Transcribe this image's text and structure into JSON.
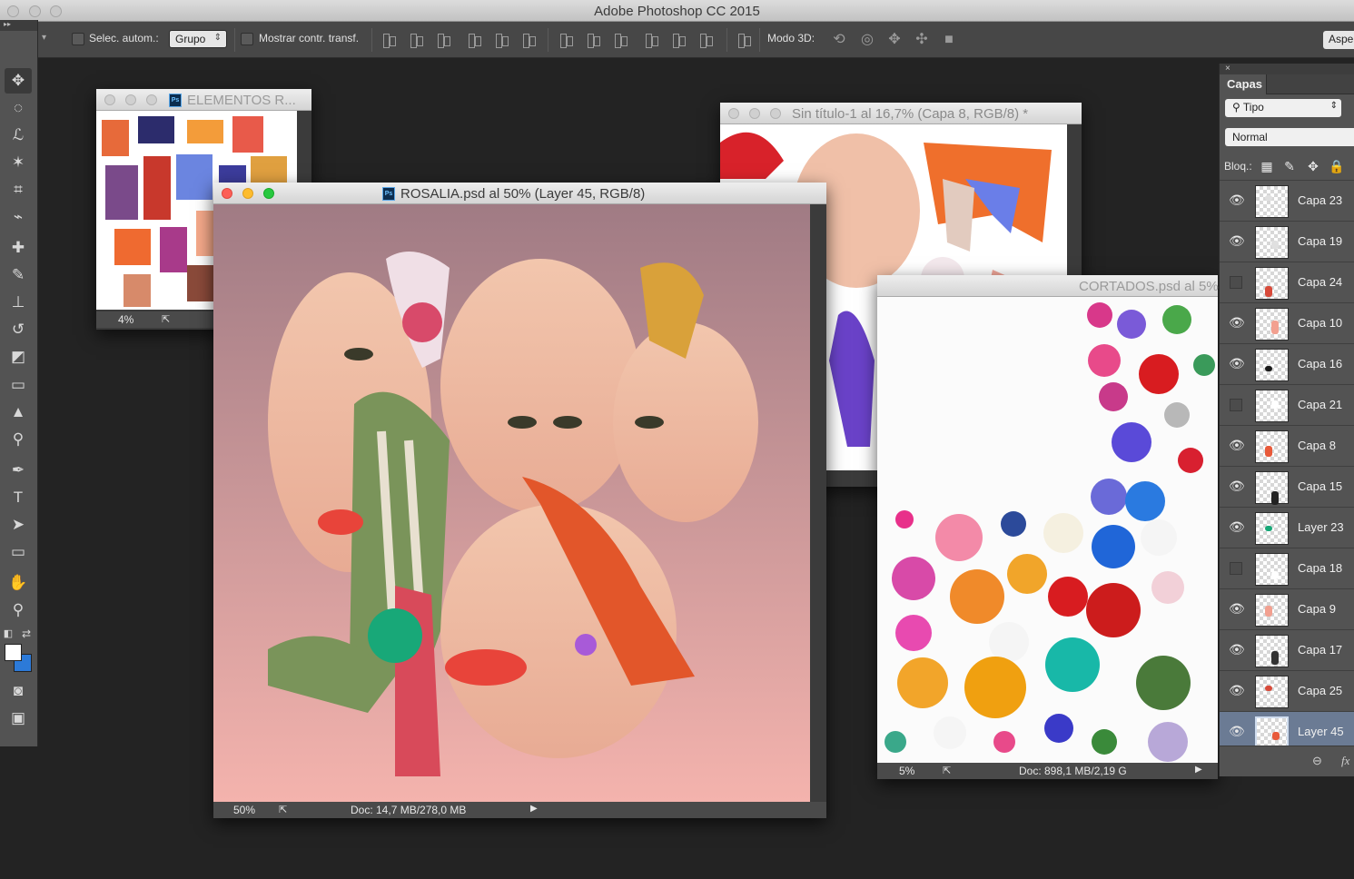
{
  "app": {
    "title": "Adobe Photoshop CC 2015"
  },
  "options": {
    "auto_select_label": "Selec. autom.:",
    "auto_select_value": "Grupo",
    "transform_label": "Mostrar contr. transf.",
    "mode3d_label": "Modo 3D:",
    "workspace_label": "Aspe"
  },
  "tools": [
    "move",
    "marquee",
    "lasso",
    "magic-wand",
    "crop",
    "eyedropper",
    "healing",
    "brush",
    "stamp",
    "history-brush",
    "eraser",
    "gradient",
    "blur",
    "dodge",
    "pen",
    "type",
    "path-select",
    "shape",
    "hand",
    "zoom"
  ],
  "docs": {
    "elementos": {
      "title": "ELEMENTOS R...",
      "zoom": "4%"
    },
    "rosalia": {
      "title": "ROSALIA.psd al 50% (Layer 45, RGB/8)",
      "zoom": "50%",
      "doc_size": "Doc: 14,7 MB/278,0 MB"
    },
    "sintitulo": {
      "title": "Sin título-1 al 16,7% (Capa 8, RGB/8) *"
    },
    "recortados": {
      "title": "CORTADOS.psd al 5%",
      "zoom": "5%",
      "doc_size": "Doc: 898,1 MB/2,19 G"
    }
  },
  "layers_panel": {
    "tab": "Capas",
    "filter": "Tipo",
    "blend_mode": "Normal",
    "lock_label": "Bloq.:",
    "layers": [
      {
        "name": "Capa 23",
        "visible": true,
        "selected": false
      },
      {
        "name": "Capa 19",
        "visible": true,
        "selected": false
      },
      {
        "name": "Capa 24",
        "visible": false,
        "selected": false
      },
      {
        "name": "Capa 10",
        "visible": true,
        "selected": false
      },
      {
        "name": "Capa 16",
        "visible": true,
        "selected": false
      },
      {
        "name": "Capa 21",
        "visible": false,
        "selected": false
      },
      {
        "name": "Capa 8",
        "visible": true,
        "selected": false
      },
      {
        "name": "Capa 15",
        "visible": true,
        "selected": false
      },
      {
        "name": "Layer 23",
        "visible": true,
        "selected": false
      },
      {
        "name": "Capa 18",
        "visible": false,
        "selected": false
      },
      {
        "name": "Capa 9",
        "visible": true,
        "selected": false
      },
      {
        "name": "Capa 17",
        "visible": true,
        "selected": false
      },
      {
        "name": "Capa 25",
        "visible": true,
        "selected": false
      },
      {
        "name": "Layer 45",
        "visible": true,
        "selected": true
      }
    ]
  },
  "colors": {
    "foreground": "#ffffff",
    "background": "#2c7ad8",
    "selection": "#6b7b94"
  }
}
